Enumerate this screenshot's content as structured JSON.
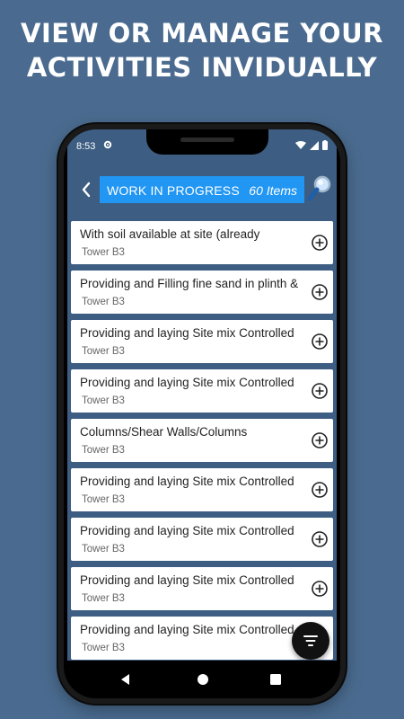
{
  "headline": {
    "line1": "VIEW OR MANAGE YOUR",
    "line2": "ACTIVITIES INVIDUALLY"
  },
  "status_bar": {
    "time": "8:53",
    "icons": [
      "gear-icon",
      "wifi-icon",
      "signal-icon",
      "battery-icon"
    ]
  },
  "app_bar": {
    "title": "WORK IN PROGRESS",
    "count": "60 Items",
    "back_icon": "back-chevron-icon",
    "search_icon": "magnifier-icon",
    "accent": "#2196f3"
  },
  "activities": [
    {
      "title": "With soil available at site (already",
      "location": "Tower B3"
    },
    {
      "title": "Providing and  Filling  fine sand in plinth &",
      "location": "Tower B3"
    },
    {
      "title": "Providing and laying Site mix  Controlled",
      "location": "Tower B3"
    },
    {
      "title": "Providing and laying Site mix  Controlled",
      "location": "Tower B3"
    },
    {
      "title": "Columns/Shear Walls/Columns",
      "location": "Tower B3"
    },
    {
      "title": "Providing and laying Site mix  Controlled",
      "location": "Tower B3"
    },
    {
      "title": "Providing and laying Site mix  Controlled",
      "location": "Tower B3"
    },
    {
      "title": "Providing and laying Site mix  Controlled",
      "location": "Tower B3"
    },
    {
      "title": "Providing and laying Site mix  Controlled",
      "location": "Tower B3"
    }
  ],
  "fab_icon": "filter-icon",
  "colors": {
    "background": "#4a6b8f",
    "screen": "#3d5d82",
    "card": "#ffffff"
  }
}
